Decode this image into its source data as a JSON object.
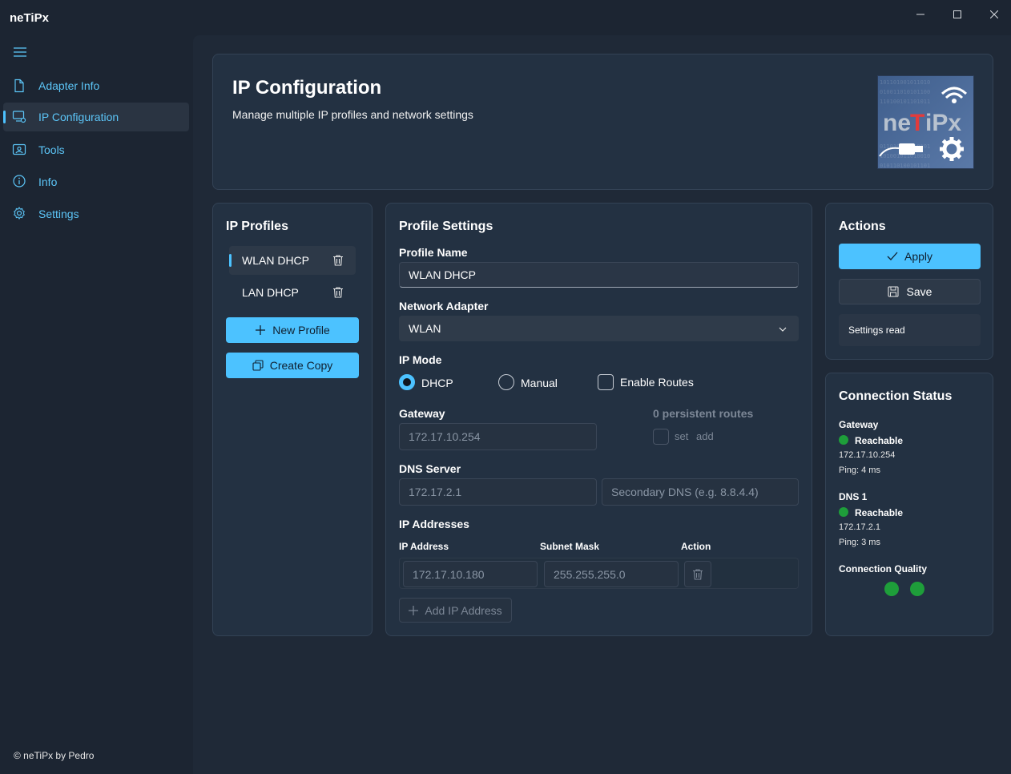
{
  "app": {
    "title": "neTiPx"
  },
  "window_controls": {
    "minimize": "minimize-icon",
    "maximize": "maximize-icon",
    "close": "close-icon"
  },
  "sidebar": {
    "menu_icon": "hamburger-icon",
    "items": [
      {
        "label": "Adapter Info",
        "icon": "document-icon"
      },
      {
        "label": "IP Configuration",
        "icon": "network-config-icon",
        "active": true
      },
      {
        "label": "Tools",
        "icon": "contact-card-icon"
      },
      {
        "label": "Info",
        "icon": "info-icon"
      },
      {
        "label": "Settings",
        "icon": "gear-icon"
      }
    ],
    "footer": "© neTiPx by Pedro"
  },
  "header": {
    "title": "IP Configuration",
    "subtitle": "Manage multiple IP profiles and network settings",
    "logo_text": "neTiPx"
  },
  "profiles": {
    "title": "IP Profiles",
    "items": [
      {
        "label": "WLAN DHCP",
        "active": true
      },
      {
        "label": "LAN DHCP",
        "active": false
      }
    ],
    "new_profile_label": "New Profile",
    "create_copy_label": "Create Copy"
  },
  "settings": {
    "title": "Profile Settings",
    "profile_name_label": "Profile Name",
    "profile_name_value": "WLAN DHCP",
    "adapter_label": "Network Adapter",
    "adapter_value": "WLAN",
    "ip_mode_label": "IP Mode",
    "mode_dhcp": "DHCP",
    "mode_manual": "Manual",
    "enable_routes": "Enable Routes",
    "gateway_label": "Gateway",
    "gateway_value": "172.17.10.254",
    "routes_label": "0 persistent routes",
    "routes_set": "set",
    "routes_add": "add",
    "dns_label": "DNS Server",
    "dns_primary": "172.17.2.1",
    "dns_secondary_placeholder": "Secondary DNS (e.g. 8.8.4.4)",
    "ip_addresses_label": "IP Addresses",
    "col_ip": "IP Address",
    "col_mask": "Subnet Mask",
    "col_action": "Action",
    "ip_row": {
      "ip": "172.17.10.180",
      "mask": "255.255.255.0"
    },
    "add_ip_label": "Add IP Address"
  },
  "actions": {
    "title": "Actions",
    "apply_label": "Apply",
    "save_label": "Save",
    "status_text": "Settings read"
  },
  "connection": {
    "title": "Connection Status",
    "gateway_label": "Gateway",
    "gateway_status": "Reachable",
    "gateway_ip": "172.17.10.254",
    "gateway_ping": "Ping: 4 ms",
    "dns_label": "DNS 1",
    "dns_status": "Reachable",
    "dns_ip": "172.17.2.1",
    "dns_ping": "Ping: 3 ms",
    "quality_label": "Connection Quality",
    "status_color": "#1e9e3a"
  },
  "colors": {
    "accent": "#4cc2ff",
    "background": "#1f2937",
    "card": "#233142"
  }
}
